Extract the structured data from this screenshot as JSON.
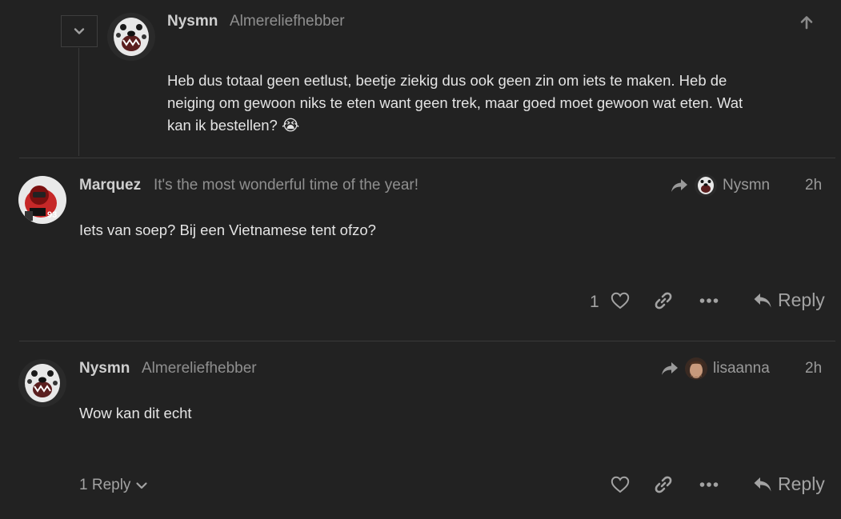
{
  "embedded_post": {
    "username": "Nysmn",
    "user_title": "Almereliefhebber",
    "body_line1": "Heb dus totaal geen eetlust, beetje ziekig dus ook geen zin om iets te maken. Heb de",
    "body_line2": "neiging om gewoon niks te eten want geen trek, maar goed moet gewoon wat eten. Wat",
    "body_line3": "kan ik bestellen?",
    "emoji": "😭"
  },
  "posts": [
    {
      "username": "Marquez",
      "user_title": "It's the most wonderful time of the year!",
      "reply_to": "Nysmn",
      "time": "2h",
      "body": "Iets van soep? Bij een Vietnamese tent ofzo?",
      "like_count": "1",
      "reply_label": "Reply"
    },
    {
      "username": "Nysmn",
      "user_title": "Almereliefhebber",
      "reply_to": "lisaanna",
      "time": "2h",
      "body": "Wow kan dit echt",
      "replies_label": "1 Reply",
      "reply_label": "Reply"
    }
  ]
}
